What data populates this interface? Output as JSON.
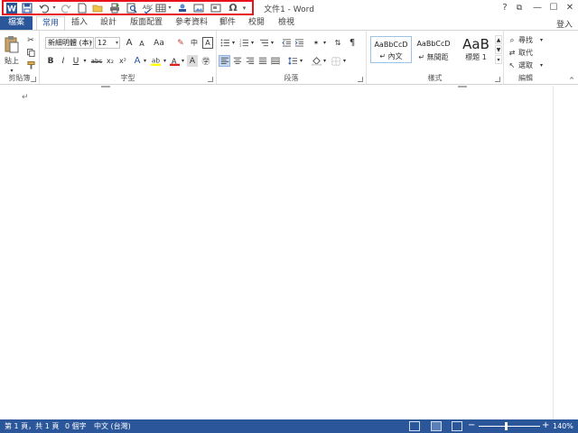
{
  "titlebar": {
    "title": "文件1 - Word",
    "help": "?",
    "restore_ribbon": "⧉",
    "minimize": "—",
    "maximize": "☐",
    "close": "✕"
  },
  "qat": {
    "highlight_color": "#e8121c",
    "buttons": [
      "word-logo-icon",
      "save-icon",
      "undo-icon",
      "redo-icon",
      "new-doc-icon",
      "open-folder-icon",
      "print-icon",
      "print-preview-icon",
      "spelling-icon",
      "table-icon",
      "hyperlink-icon",
      "picture-icon",
      "textbox-icon",
      "symbol-icon",
      "customize-icon"
    ],
    "symbol_glyph": "Ω"
  },
  "tabs": {
    "file": "檔案",
    "home": "常用",
    "insert": "插入",
    "design": "設計",
    "layout": "版面配置",
    "references": "參考資料",
    "mailings": "郵件",
    "review": "校閱",
    "view": "檢視",
    "signin": "登入"
  },
  "ribbon": {
    "clipboard": {
      "label": "剪貼簿",
      "paste": "貼上"
    },
    "font": {
      "label": "字型",
      "font_name": "新細明體 (本)",
      "font_size": "12",
      "grow": "A",
      "shrink": "A",
      "case": "Aa",
      "bold": "B",
      "italic": "I",
      "underline": "U",
      "strike": "abc",
      "subscript": "x₂",
      "superscript": "x²"
    },
    "paragraph": {
      "label": "段落"
    },
    "styles": {
      "label": "樣式",
      "items": [
        {
          "sample": "AaBbCcD",
          "name": "↵ 內文"
        },
        {
          "sample": "AaBbCcD",
          "name": "↵ 無間距"
        },
        {
          "sample": "AaB",
          "name": "標題 1"
        }
      ]
    },
    "editing": {
      "label": "編輯",
      "find": "尋找",
      "replace": "取代",
      "select": "選取"
    }
  },
  "document": {
    "para_mark": "↵"
  },
  "statusbar": {
    "page": "第 1 頁，共 1 頁",
    "words": "0 個字",
    "language": "中文 (台灣)",
    "zoom_minus": "−",
    "zoom_plus": "+",
    "zoom": "140%",
    "zoom_level": 0.44,
    "bg_color": "#2b579a"
  }
}
